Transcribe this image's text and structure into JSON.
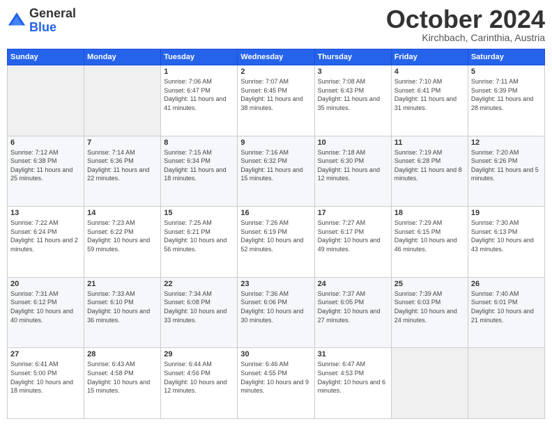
{
  "header": {
    "logo_general": "General",
    "logo_blue": "Blue",
    "month_title": "October 2024",
    "subtitle": "Kirchbach, Carinthia, Austria"
  },
  "days_of_week": [
    "Sunday",
    "Monday",
    "Tuesday",
    "Wednesday",
    "Thursday",
    "Friday",
    "Saturday"
  ],
  "weeks": [
    [
      {
        "day": "",
        "info": ""
      },
      {
        "day": "",
        "info": ""
      },
      {
        "day": "1",
        "info": "Sunrise: 7:06 AM\nSunset: 6:47 PM\nDaylight: 11 hours and 41 minutes."
      },
      {
        "day": "2",
        "info": "Sunrise: 7:07 AM\nSunset: 6:45 PM\nDaylight: 11 hours and 38 minutes."
      },
      {
        "day": "3",
        "info": "Sunrise: 7:08 AM\nSunset: 6:43 PM\nDaylight: 11 hours and 35 minutes."
      },
      {
        "day": "4",
        "info": "Sunrise: 7:10 AM\nSunset: 6:41 PM\nDaylight: 11 hours and 31 minutes."
      },
      {
        "day": "5",
        "info": "Sunrise: 7:11 AM\nSunset: 6:39 PM\nDaylight: 11 hours and 28 minutes."
      }
    ],
    [
      {
        "day": "6",
        "info": "Sunrise: 7:12 AM\nSunset: 6:38 PM\nDaylight: 11 hours and 25 minutes."
      },
      {
        "day": "7",
        "info": "Sunrise: 7:14 AM\nSunset: 6:36 PM\nDaylight: 11 hours and 22 minutes."
      },
      {
        "day": "8",
        "info": "Sunrise: 7:15 AM\nSunset: 6:34 PM\nDaylight: 11 hours and 18 minutes."
      },
      {
        "day": "9",
        "info": "Sunrise: 7:16 AM\nSunset: 6:32 PM\nDaylight: 11 hours and 15 minutes."
      },
      {
        "day": "10",
        "info": "Sunrise: 7:18 AM\nSunset: 6:30 PM\nDaylight: 11 hours and 12 minutes."
      },
      {
        "day": "11",
        "info": "Sunrise: 7:19 AM\nSunset: 6:28 PM\nDaylight: 11 hours and 8 minutes."
      },
      {
        "day": "12",
        "info": "Sunrise: 7:20 AM\nSunset: 6:26 PM\nDaylight: 11 hours and 5 minutes."
      }
    ],
    [
      {
        "day": "13",
        "info": "Sunrise: 7:22 AM\nSunset: 6:24 PM\nDaylight: 11 hours and 2 minutes."
      },
      {
        "day": "14",
        "info": "Sunrise: 7:23 AM\nSunset: 6:22 PM\nDaylight: 10 hours and 59 minutes."
      },
      {
        "day": "15",
        "info": "Sunrise: 7:25 AM\nSunset: 6:21 PM\nDaylight: 10 hours and 56 minutes."
      },
      {
        "day": "16",
        "info": "Sunrise: 7:26 AM\nSunset: 6:19 PM\nDaylight: 10 hours and 52 minutes."
      },
      {
        "day": "17",
        "info": "Sunrise: 7:27 AM\nSunset: 6:17 PM\nDaylight: 10 hours and 49 minutes."
      },
      {
        "day": "18",
        "info": "Sunrise: 7:29 AM\nSunset: 6:15 PM\nDaylight: 10 hours and 46 minutes."
      },
      {
        "day": "19",
        "info": "Sunrise: 7:30 AM\nSunset: 6:13 PM\nDaylight: 10 hours and 43 minutes."
      }
    ],
    [
      {
        "day": "20",
        "info": "Sunrise: 7:31 AM\nSunset: 6:12 PM\nDaylight: 10 hours and 40 minutes."
      },
      {
        "day": "21",
        "info": "Sunrise: 7:33 AM\nSunset: 6:10 PM\nDaylight: 10 hours and 36 minutes."
      },
      {
        "day": "22",
        "info": "Sunrise: 7:34 AM\nSunset: 6:08 PM\nDaylight: 10 hours and 33 minutes."
      },
      {
        "day": "23",
        "info": "Sunrise: 7:36 AM\nSunset: 6:06 PM\nDaylight: 10 hours and 30 minutes."
      },
      {
        "day": "24",
        "info": "Sunrise: 7:37 AM\nSunset: 6:05 PM\nDaylight: 10 hours and 27 minutes."
      },
      {
        "day": "25",
        "info": "Sunrise: 7:39 AM\nSunset: 6:03 PM\nDaylight: 10 hours and 24 minutes."
      },
      {
        "day": "26",
        "info": "Sunrise: 7:40 AM\nSunset: 6:01 PM\nDaylight: 10 hours and 21 minutes."
      }
    ],
    [
      {
        "day": "27",
        "info": "Sunrise: 6:41 AM\nSunset: 5:00 PM\nDaylight: 10 hours and 18 minutes."
      },
      {
        "day": "28",
        "info": "Sunrise: 6:43 AM\nSunset: 4:58 PM\nDaylight: 10 hours and 15 minutes."
      },
      {
        "day": "29",
        "info": "Sunrise: 6:44 AM\nSunset: 4:56 PM\nDaylight: 10 hours and 12 minutes."
      },
      {
        "day": "30",
        "info": "Sunrise: 6:46 AM\nSunset: 4:55 PM\nDaylight: 10 hours and 9 minutes."
      },
      {
        "day": "31",
        "info": "Sunrise: 6:47 AM\nSunset: 4:53 PM\nDaylight: 10 hours and 6 minutes."
      },
      {
        "day": "",
        "info": ""
      },
      {
        "day": "",
        "info": ""
      }
    ]
  ]
}
